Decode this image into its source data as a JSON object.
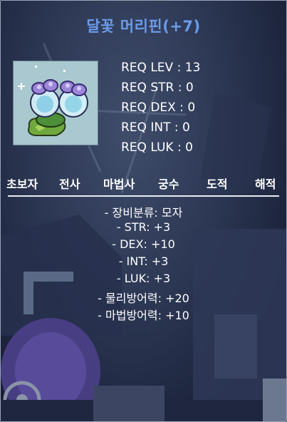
{
  "item": {
    "name": "달꽃 머리핀(+7)",
    "icon": "moonflower-hairpin-icon"
  },
  "requirements": [
    {
      "label": "REQ LEV",
      "value": "13"
    },
    {
      "label": "REQ STR",
      "value": "0"
    },
    {
      "label": "REQ DEX",
      "value": "0"
    },
    {
      "label": "REQ INT",
      "value": "0"
    },
    {
      "label": "REQ LUK",
      "value": "0"
    }
  ],
  "req_text": [
    "REQ LEV : 13",
    "REQ STR : 0",
    "REQ DEX : 0",
    "REQ INT : 0",
    "REQ LUK : 0"
  ],
  "jobs": [
    "초보자",
    "전사",
    "마법사",
    "궁수",
    "도적",
    "해적"
  ],
  "stats": [
    "- 장비분류: 모자",
    "- STR: +3",
    "- DEX: +10",
    "- INT: +3",
    "- LUK: +3",
    "- 물리방어력: +20",
    "- 마법방어력: +10"
  ],
  "colors": {
    "title": "#6b9bea",
    "text": "#ffffff",
    "icon_bg": "#a9c8cf"
  }
}
